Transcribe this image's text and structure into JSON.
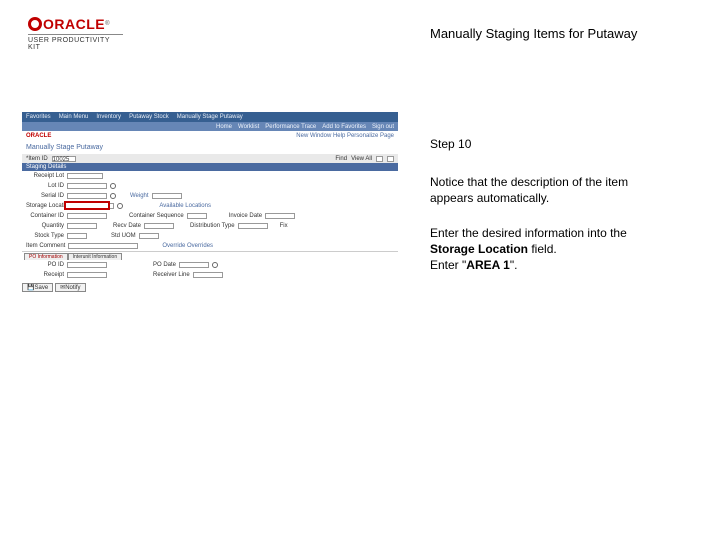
{
  "logo": {
    "brand": "ORACLE",
    "subline": "USER PRODUCTIVITY KIT"
  },
  "title": "Manually Staging Items for Putaway",
  "instructions": {
    "step": "Step 10",
    "para1": "Notice that the description of the item appears automatically.",
    "para2a": "Enter the desired information into the ",
    "para2b_field": "Storage Location",
    "para2c": " field.",
    "para3a": "Enter \"",
    "para3b_value": "AREA 1",
    "para3c": "\"."
  },
  "shot": {
    "menubar": [
      "Favorites",
      "Main Menu",
      "Inventory",
      "Putaway Stock",
      "Manually Stage Putaway"
    ],
    "submenu": [
      "Home",
      "Worklist",
      "Performance Trace",
      "Add to Favorites",
      "Sign out"
    ],
    "brand_small": "ORACLE",
    "toplinks": "New Window  Help  Personalize Page",
    "section_title": "Manually Stage Putaway",
    "item_label": "*Item ID",
    "item_value": "10025",
    "find_label": "Find",
    "view_all_label": "View All",
    "bluebar": "Staging Details",
    "row_receipt_lot": "Receipt Lot",
    "row_lot_id": "Lot ID",
    "row_serial_id": "Serial ID",
    "row_storage_loc": "Storage Location",
    "row_container_id": "Container ID",
    "row_quantity": "Quantity",
    "row_stock_type": "Stock Type",
    "row_item_comment": "Item Comment",
    "row_container_seq": "Container Sequence",
    "row_recv_date": "Recv Date",
    "row_stdulom": "Std UOM",
    "row_po_date": "PO Date",
    "row_receiver_line": "Receiver Line",
    "row_weight": "Weight",
    "row_fix": "Fix",
    "row_avail_loc": "Available Locations",
    "row_invoice_date": "Invoice Date",
    "row_distrib": "Distribution Type",
    "row_override": "Override Overrides",
    "tabs": [
      "PO Information",
      "Interunit Information"
    ],
    "btn_save": "Save",
    "btn_notify": "Notify"
  }
}
